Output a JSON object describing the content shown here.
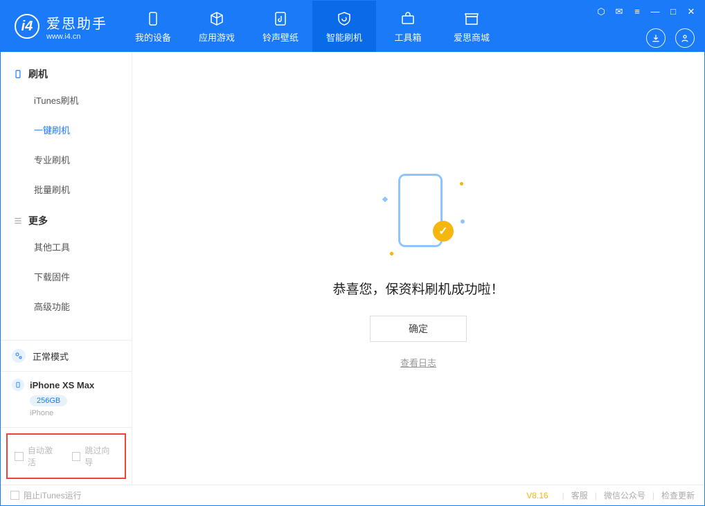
{
  "app": {
    "title": "爱思助手",
    "subtitle": "www.i4.cn"
  },
  "tabs": [
    {
      "label": "我的设备"
    },
    {
      "label": "应用游戏"
    },
    {
      "label": "铃声壁纸"
    },
    {
      "label": "智能刷机"
    },
    {
      "label": "工具箱"
    },
    {
      "label": "爱思商城"
    }
  ],
  "sidebar": {
    "section1": {
      "title": "刷机",
      "items": [
        "iTunes刷机",
        "一键刷机",
        "专业刷机",
        "批量刷机"
      ]
    },
    "section2": {
      "title": "更多",
      "items": [
        "其他工具",
        "下载固件",
        "高级功能"
      ]
    },
    "mode": "正常模式",
    "device": {
      "name": "iPhone XS Max",
      "storage": "256GB",
      "type": "iPhone"
    },
    "options": {
      "auto_activate": "自动激活",
      "skip_guide": "跳过向导"
    }
  },
  "main": {
    "success_text": "恭喜您，保资料刷机成功啦！",
    "ok": "确定",
    "view_log": "查看日志"
  },
  "footer": {
    "block_itunes": "阻止iTunes运行",
    "version": "V8.16",
    "links": [
      "客服",
      "微信公众号",
      "检查更新"
    ]
  }
}
